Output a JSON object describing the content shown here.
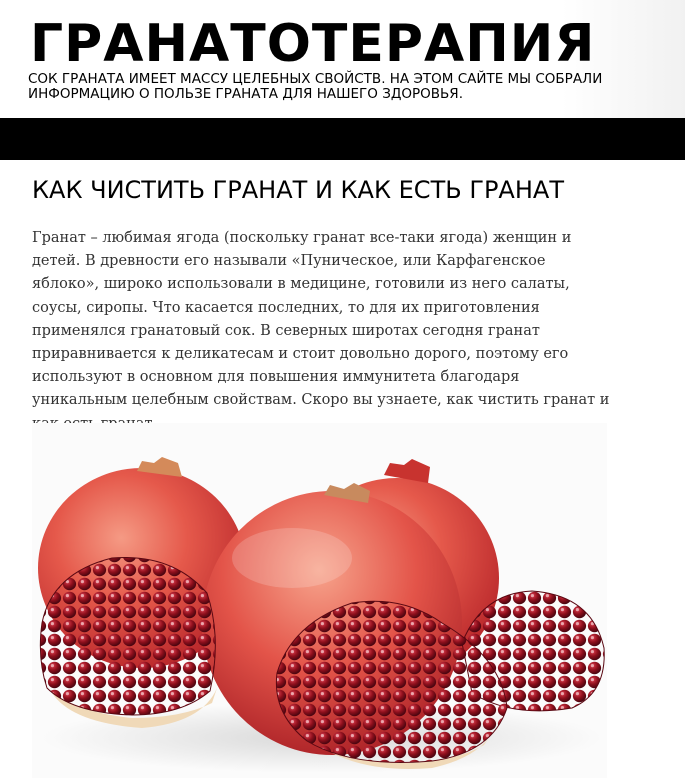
{
  "header": {
    "site_title": "ГРАНАТОТЕРАПИЯ",
    "tagline": "СОК ГРАНАТА ИМЕЕТ МАССУ ЦЕЛЕБНЫХ СВОЙСТВ. НА ЭТОМ САЙТЕ МЫ СОБРАЛИ ИНФОРМАЦИЮ О ПОЛЬЗЕ ГРАНАТА ДЛЯ НАШЕГО ЗДОРОВЬЯ."
  },
  "article": {
    "title": "КАК ЧИСТИТЬ ГРАНАТ И КАК ЕСТЬ ГРАНАТ",
    "body": "Гранат – любимая ягода (поскольку гранат все-таки ягода) женщин и детей. В древности его называли «Пуническое, или Карфагенское яблоко», широко использовали в медицине, готовили из него салаты, соусы, сиропы. Что касается последних, то для их приготовления применялся гранатовый сок. В северных широтах сегодня гранат приравнивается к деликатесам и стоит довольно дорого, поэтому его используют в основном для повышения иммунитета благодаря уникальным целебным свойствам. Скоро вы узнаете, как чистить гранат и как есть гранат."
  },
  "colors": {
    "nav_bar": "#000000",
    "fruit_skin": "#e2564a",
    "arils": "#8e0f1c"
  }
}
